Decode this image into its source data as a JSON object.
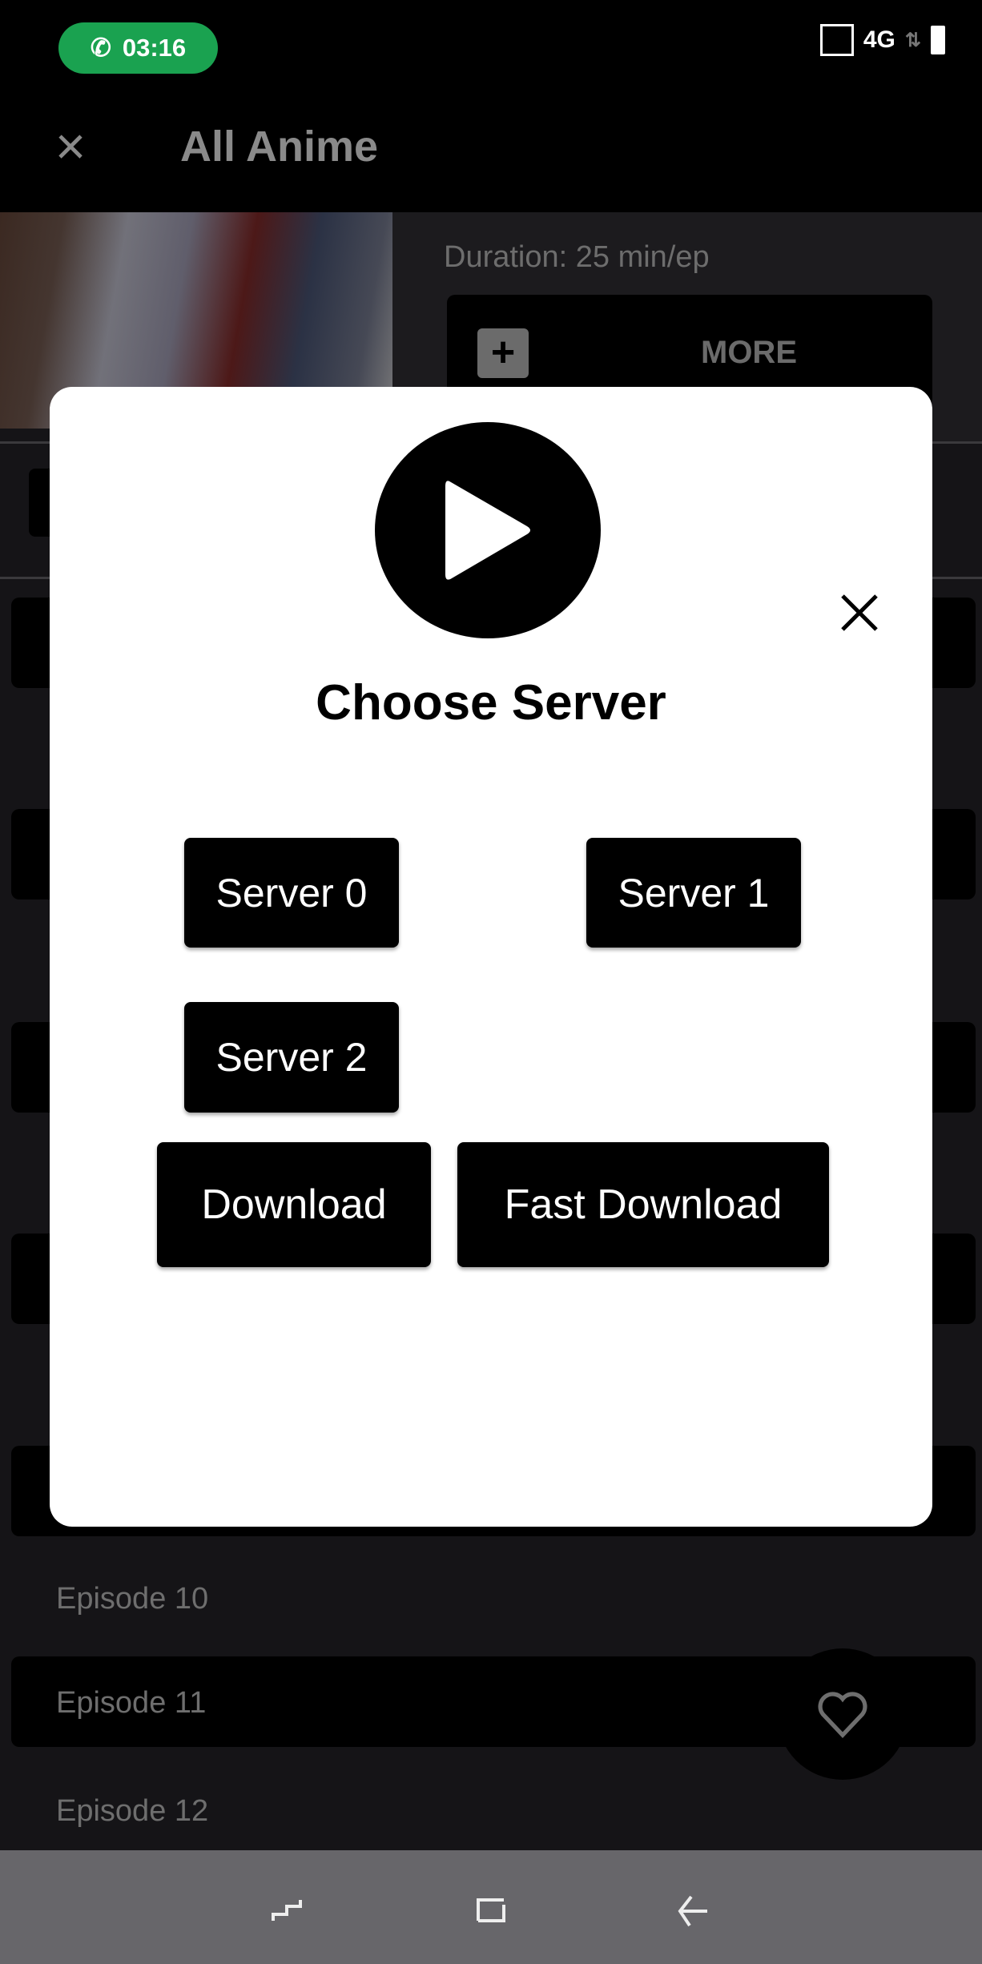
{
  "status_bar": {
    "time": "03:16",
    "network": "4G",
    "call_color": "#1aa250"
  },
  "toolbar": {
    "title": "All Anime",
    "close_icon": "close-icon"
  },
  "details": {
    "duration": "Duration: 25 min/ep",
    "more_label": "MORE"
  },
  "episodes": [
    "Episode 10",
    "Episode 11",
    "Episode 12"
  ],
  "dialog": {
    "title": "Choose Server",
    "servers": [
      "Server 0",
      "Server 1",
      "Server 2"
    ],
    "download": "Download",
    "fast_download": "Fast Download"
  },
  "fab": {
    "icon": "heart-icon"
  },
  "nav": {
    "icons": [
      "recents-icon",
      "home-icon",
      "back-icon"
    ]
  }
}
